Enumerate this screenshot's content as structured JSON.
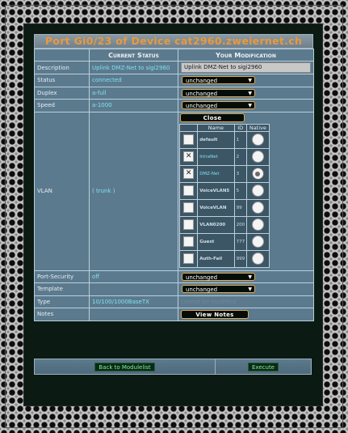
{
  "page": {
    "title": "Port Gi0/23 of Device cat2960.zweiernet.ch"
  },
  "table": {
    "col_current": "Current Status",
    "col_modification": "Your Modification"
  },
  "rows": {
    "description": {
      "label": "Description",
      "current": "Uplink DMZ-Net to sigi2960",
      "mod_value": "Uplink DMZ-Net to sigi2960"
    },
    "status": {
      "label": "Status",
      "current": "connected",
      "mod_value": "unchanged"
    },
    "duplex": {
      "label": "Duplex",
      "current": "a-full",
      "mod_value": "unchanged"
    },
    "speed": {
      "label": "Speed",
      "current": "a-1000",
      "mod_value": "unchanged"
    },
    "vlan": {
      "label": "VLAN",
      "current": "( trunk )",
      "close_label": "Close"
    },
    "port_security": {
      "label": "Port-Security",
      "current": "off",
      "mod_value": "unchanged"
    },
    "template": {
      "label": "Template",
      "current": "",
      "mod_value": "unchanged"
    },
    "type": {
      "label": "Type",
      "current": "10/100/1000BaseTX",
      "mod_value": "cannot be modified"
    },
    "notes": {
      "label": "Notes",
      "button": "View Notes"
    }
  },
  "vlan_table": {
    "headers": {
      "name": "Name",
      "id": "ID",
      "native": "Native"
    },
    "rows": [
      {
        "name": "default",
        "id": "1",
        "checked": false,
        "native": false
      },
      {
        "name": "IntraNet",
        "id": "2",
        "checked": true,
        "native": false
      },
      {
        "name": "DMZ-Net",
        "id": "3",
        "checked": true,
        "native": true
      },
      {
        "name": "VoiceVLAN5",
        "id": "5",
        "checked": false,
        "native": false
      },
      {
        "name": "VoiceVLAN",
        "id": "99",
        "checked": false,
        "native": false
      },
      {
        "name": "VLAN0200",
        "id": "200",
        "checked": false,
        "native": false
      },
      {
        "name": "Guest",
        "id": "777",
        "checked": false,
        "native": false
      },
      {
        "name": "Auth-Fail",
        "id": "999",
        "checked": false,
        "native": false
      }
    ],
    "check_mark": "✕"
  },
  "footer": {
    "back_label": "Back to Modulelist",
    "execute_label": "Execute"
  },
  "colors": {
    "title_text": "#e89a3c",
    "value_text": "#7fe0f0",
    "cell_bg": "#5c7a8e",
    "button_border": "#e5a84a"
  }
}
